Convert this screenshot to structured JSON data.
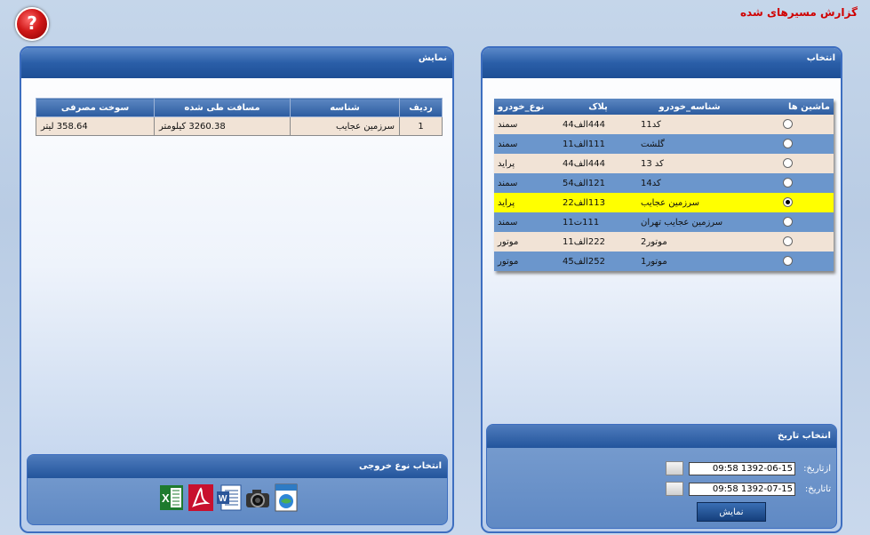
{
  "header": {
    "title": "گزارش مسیرهای شده",
    "help_glyph": "?"
  },
  "select_panel": {
    "title": "انتخاب",
    "columns": [
      "ماشین ها",
      "شناسه_خودرو",
      "پلاک",
      "نوع_خودرو"
    ],
    "rows": [
      {
        "name": "کد11",
        "plate": "444الف44",
        "type": "سمند",
        "selected": false
      },
      {
        "name": "گلشت",
        "plate": "111الف11",
        "type": "سمند",
        "selected": false
      },
      {
        "name": "کد 13",
        "plate": "444الف44",
        "type": "پراید",
        "selected": false
      },
      {
        "name": "کد14",
        "plate": "121الف54",
        "type": "سمند",
        "selected": false
      },
      {
        "name": "سرزمین عجایب",
        "plate": "113الف22",
        "type": "پراید",
        "selected": true
      },
      {
        "name": "سرزمین عجایب تهران",
        "plate": "111ت11",
        "type": "سمند",
        "selected": false
      },
      {
        "name": "موتور2",
        "plate": "222الف11",
        "type": "موتور",
        "selected": false
      },
      {
        "name": "موتور1",
        "plate": "252الف45",
        "type": "موتور",
        "selected": false
      }
    ]
  },
  "date_panel": {
    "title": "انتخاب تاریخ",
    "from_label": "ازتاریخ:",
    "from_value": "09:58 1392-06-15",
    "to_label": "تاتاریخ:",
    "to_value": "09:58 1392-07-15",
    "show_button": "نمایش"
  },
  "display_panel": {
    "title": "نمایش",
    "columns": [
      "ردیف",
      "شناسه",
      "مسافت طی شده",
      "سوخت مصرفی"
    ],
    "rows": [
      {
        "index": "1",
        "name": "سرزمین عجایب",
        "distance": "3260.38 کیلومتر",
        "fuel": "358.64 لیتر"
      }
    ]
  },
  "export_panel": {
    "title": "انتخاب نوع خروجی",
    "icons": [
      "excel-icon",
      "pdf-icon",
      "word-icon",
      "camera-icon",
      "image-file-icon"
    ]
  }
}
